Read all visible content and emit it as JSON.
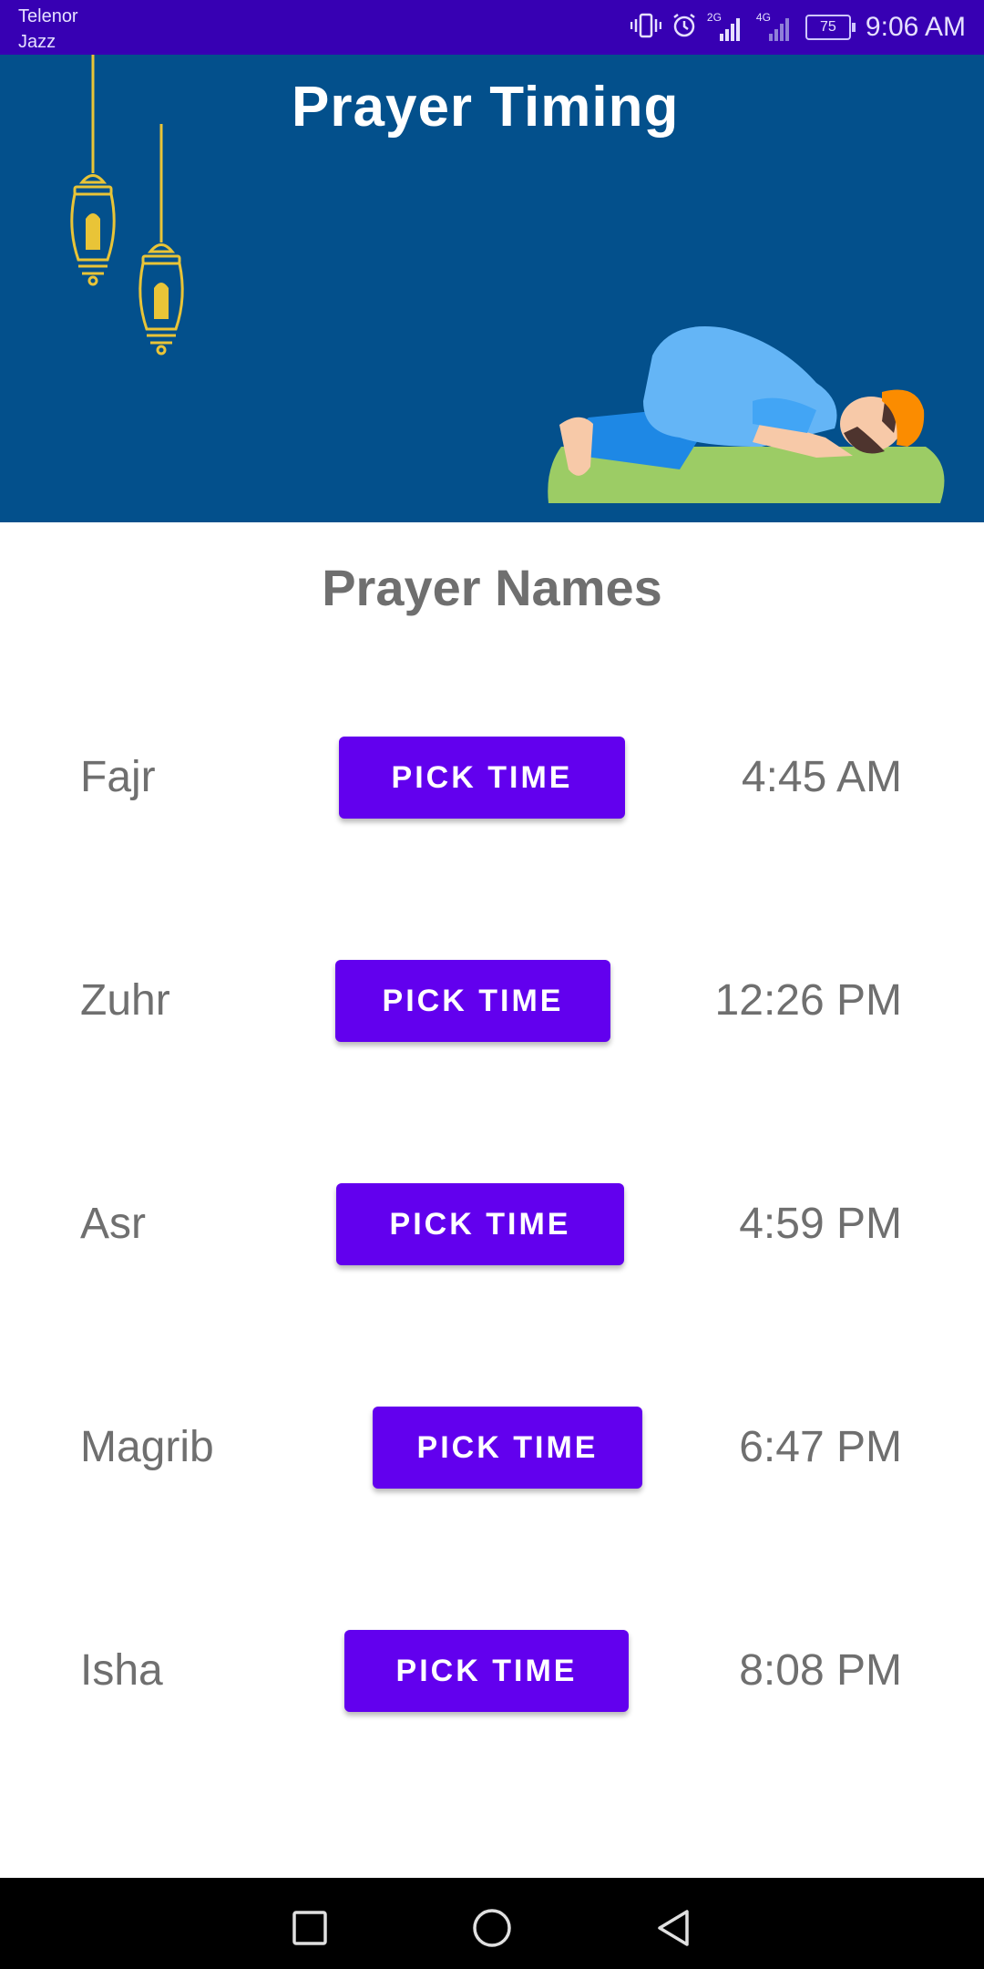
{
  "status_bar": {
    "carrier_line1": "Telenor",
    "carrier_line2": "Jazz",
    "network_2g": "2G",
    "network_4g": "4G",
    "battery_level": "75",
    "time": "9:06 AM",
    "icons": [
      "vibrate-icon",
      "alarm-icon",
      "signal-icon",
      "battery-icon"
    ]
  },
  "header": {
    "title": "Prayer Timing",
    "background_color": "#03508c",
    "illustrations": [
      "lantern-icon",
      "praying-man-illustration"
    ]
  },
  "section_title": "Prayer Names",
  "prayers": [
    {
      "name": "Fajr",
      "button_label": "PICK TIME",
      "time": "4:45 AM"
    },
    {
      "name": "Zuhr",
      "button_label": "PICK TIME",
      "time": "12:26 PM"
    },
    {
      "name": "Asr",
      "button_label": "PICK TIME",
      "time": "4:59 PM"
    },
    {
      "name": "Magrib",
      "button_label": "PICK TIME",
      "time": "6:47 PM"
    },
    {
      "name": "Isha",
      "button_label": "PICK TIME",
      "time": "8:08 PM"
    }
  ],
  "colors": {
    "accent": "#6200ee",
    "status_bar": "#3700b3",
    "text_gray": "#6f6f6f"
  },
  "nav_bar": {
    "icons": [
      "recents-square-icon",
      "home-circle-icon",
      "back-triangle-icon"
    ]
  }
}
